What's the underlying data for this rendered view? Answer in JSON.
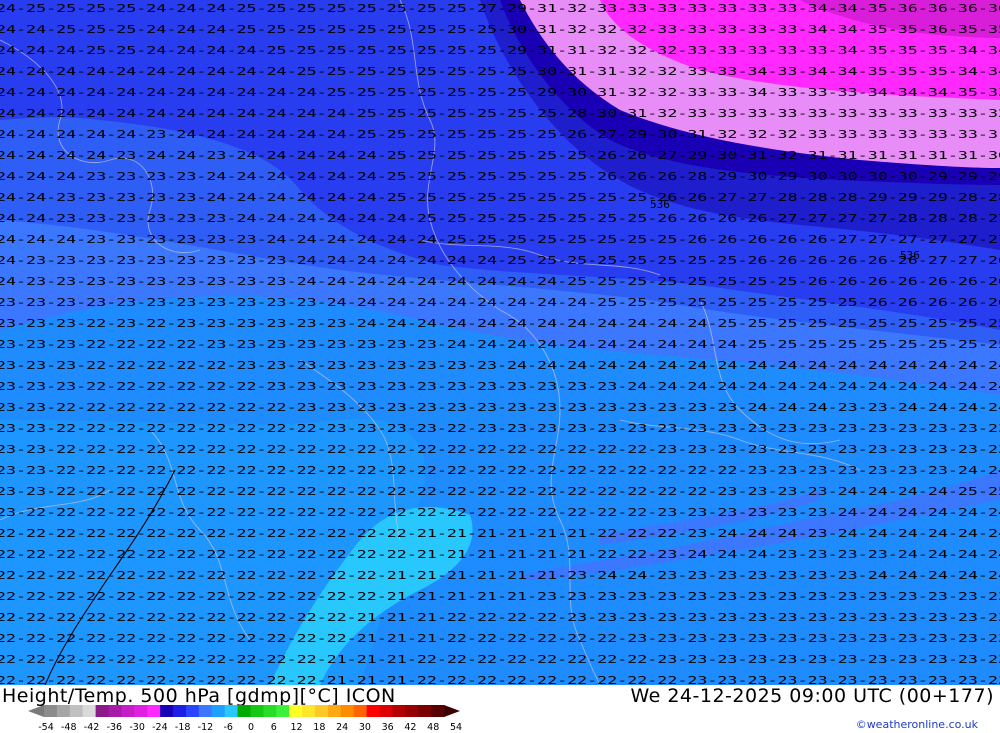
{
  "header": {
    "title": "Height/Temp. 500 hPa [gdmp][°C] ICON",
    "datetime": "We 24-12-2025 09:00 UTC (00+177)",
    "credit": "©weatheronline.co.uk"
  },
  "map": {
    "contour_labels": [
      {
        "text": "536",
        "pos": "center"
      },
      {
        "text": "536",
        "pos": "right"
      }
    ],
    "value_rows": [
      "24-25-25-25-25-24-24-24-25-25-25-25-25-25-25-25-27-29-31-32-33-33-33-33-33-33-33-34-34-35-36-36-36-36",
      "24-24-25-25-25-24-24-24-25-25-25-25-25-25-25-25-25-30-31-32-32-32-33-33-33-33-33-34-34-35-35-36-35-35",
      "24-24-24-25-25-24-24-24-24-25-25-25-25-25-25-25-25-29-31-31-32-32-32-33-33-33-33-33-34-35-35-35-34-34",
      "24-24-24-24-24-24-24-24-24-24-25-25-25-25-25-25-25-25-30-31-31-32-32-33-33-34-33-34-34-35-35-35-34-34",
      "24-24-24-24-24-24-24-24-24-24-24-25-25-25-25-25-25-25-29-30-31-32-32-33-33-34-33-33-33-34-34-34-35-33",
      "24-24-24-24-24-24-24-24-24-24-24-24-25-25-25-25-25-25-25-28-30-31-32-33-33-33-33-33-33-33-33-33-33-32",
      "24-24-24-24-24-23-24-24-24-24-24-24-25-25-25-25-25-25-25-26-27-29-30-31-32-32-32-33-33-33-33-33-33-31",
      "24-24-24-24-23-24-24-23-24-24-24-24-24-25-25-25-25-25-25-25-26-26-27-29-30-31-32-31-31-31-31-31-31-30",
      "24-24-24-23-23-23-23-24-24-24-24-24-24-25-25-25-25-25-25-25-26-26-26-28-29-30-29-30-30-30-30-29-29-29",
      "24-24-23-23-23-23-23-24-24-24-24-24-24-25-25-25-25-25-25-25-25-25-26-26-27-27-28-28-28-29-29-29-28-28",
      "24-24-23-23-23-23-23-23-24-24-24-24-24-24-25-25-25-25-25-25-25-25-26-26-26-26-27-27-27-27-28-28-28-27",
      "24-24-24-23-23-23-23-23-23-24-24-24-24-24-24-25-25-25-25-25-25-25-25-26-26-26-26-26-27-27-27-27-27-27",
      "24-23-23-23-23-23-23-23-23-23-24-24-24-24-24-24-24-25-25-25-25-25-25-25-25-26-26-26-26-26-26-27-27-26",
      "24-23-23-23-23-23-23-23-23-23-24-24-24-24-24-24-24-24-24-25-25-25-25-25-25-25-25-26-26-26-26-26-26-26",
      "23-23-23-23-23-23-23-23-23-23-23-24-24-24-24-24-24-24-24-24-25-25-25-25-25-25-25-25-25-26-26-26-26-26",
      "23-23-23-22-23-22-23-23-23-23-23-23-24-24-24-24-24-24-24-24-24-24-24-24-25-25-25-25-25-25-25-25-25-25",
      "23-23-23-22-22-22-22-23-23-23-23-23-23-23-23-24-24-24-24-24-24-24-24-24-24-25-25-25-25-25-25-25-25-25",
      "23-23-23-22-22-22-22-22-23-23-23-23-23-23-23-23-23-24-24-24-24-24-24-24-24-24-24-24-24-24-24-24-24-24",
      "23-23-23-22-22-22-22-22-22-23-23-23-23-23-23-23-23-23-23-23-23-24-24-24-24-24-24-24-24-24-24-24-24-24",
      "23-23-22-22-22-22-22-22-22-22-23-23-23-23-23-23-23-23-23-23-23-23-23-23-23-24-24-24-23-23-24-24-24-24",
      "23-23-22-22-22-22-22-22-22-22-22-23-23-23-23-22-23-23-23-23-23-23-23-23-23-23-23-23-23-23-23-23-23-23",
      "23-23-22-22-22-22-22-22-22-22-22-22-22-22-22-22-22-22-22-22-22-22-23-23-23-23-23-23-23-23-23-23-23-23",
      "23-23-22-22-22-22-22-22-22-22-22-22-22-22-22-22-22-22-22-22-22-22-22-22-22-23-23-23-23-23-23-23-24-24",
      "23-23-22-22-22-22-22-22-22-22-22-22-22-22-22-22-22-22-22-22-22-22-22-22-23-23-23-23-24-24-24-24-25-25",
      "23-22-22-22-22-22-22-22-22-22-22-22-22-22-22-22-22-22-22-22-22-22-23-23-23-23-23-23-24-24-24-24-24-24",
      "22-22-22-22-22-22-22-22-22-22-22-22-22-22-21-21-21-21-21-21-22-22-22-23-24-24-24-23-24-24-24-24-24-24",
      "22-22-22-22-22-22-22-22-22-22-22-22-22-22-21-21-21-21-21-21-22-22-23-24-24-24-23-23-23-23-24-24-24-24",
      "22-22-22-22-22-22-22-22-22-22-22-22-22-21-21-21-21-21-21-23-24-24-23-23-23-23-23-23-23-24-24-24-24-24",
      "22-22-22-22-22-22-22-22-22-22-22-22-22-21-21-21-21-21-23-23-23-23-23-23-23-23-23-23-23-23-23-23-23-23",
      "22-22-22-22-22-22-22-22-22-22-22-22-21-21-21-22-22-22-22-23-23-23-23-23-23-23-23-23-23-23-23-23-23-23",
      "22-22-22-22-22-22-22-22-22-22-22-22-21-21-21-22-22-22-22-22-22-23-23-23-23-23-23-23-23-23-23-23-23-23",
      "22-22-22-22-22-22-22-22-22-22-22-21-21-21-22-22-22-22-22-22-22-22-23-23-23-23-23-23-23-23-23-23-23-23",
      "22-22-22-22-22-22-22-22-22-22-22-21-21-21-22-22-22-22-22-22-22-22-22-23-23-23-23-23-23-23-23-23-23-23"
    ]
  },
  "legend": {
    "tick_labels": [
      "-54",
      "-48",
      "-42",
      "-36",
      "-30",
      "-24",
      "-18",
      "-12",
      "-6",
      "0",
      "6",
      "12",
      "18",
      "24",
      "30",
      "36",
      "42",
      "48",
      "54"
    ],
    "colors": [
      "#8c8c8c",
      "#a6a6a6",
      "#c0c0c0",
      "#dadada",
      "#8b1a8b",
      "#a81aa8",
      "#c41ec4",
      "#e020e0",
      "#ff28ff",
      "#1a00b4",
      "#1e1ee6",
      "#2846ff",
      "#3c78ff",
      "#1ea0ff",
      "#28c8ff",
      "#00aa00",
      "#14c814",
      "#28dc28",
      "#3cf03c",
      "#ffff28",
      "#ffe628",
      "#ffc828",
      "#ffaa14",
      "#ff8c00",
      "#ff6400",
      "#ff0000",
      "#dc0000",
      "#b40000",
      "#960000",
      "#780000",
      "#5a0000"
    ]
  }
}
